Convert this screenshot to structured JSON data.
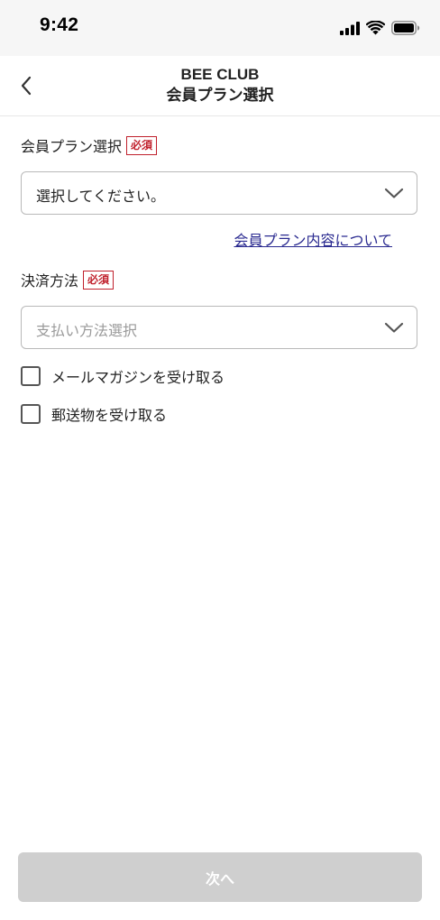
{
  "status_bar": {
    "time": "9:42"
  },
  "header": {
    "club_name": "BEE CLUB",
    "page_title": "会員プラン選択"
  },
  "plan_field": {
    "label": "会員プラン選択",
    "required_badge": "必須",
    "selected_value": "選択してください。"
  },
  "plan_info_link": "会員プラン内容について",
  "payment_field": {
    "label": "決済方法",
    "required_badge": "必須",
    "placeholder": "支払い方法選択"
  },
  "options": {
    "newsletter_label": "メールマガジンを受け取る",
    "mail_label": "郵送物を受け取る"
  },
  "footer": {
    "next_label": "次へ"
  },
  "colors": {
    "required": "#c0202c",
    "link": "#2a2a90",
    "disabled_button": "#cfcfcf"
  }
}
